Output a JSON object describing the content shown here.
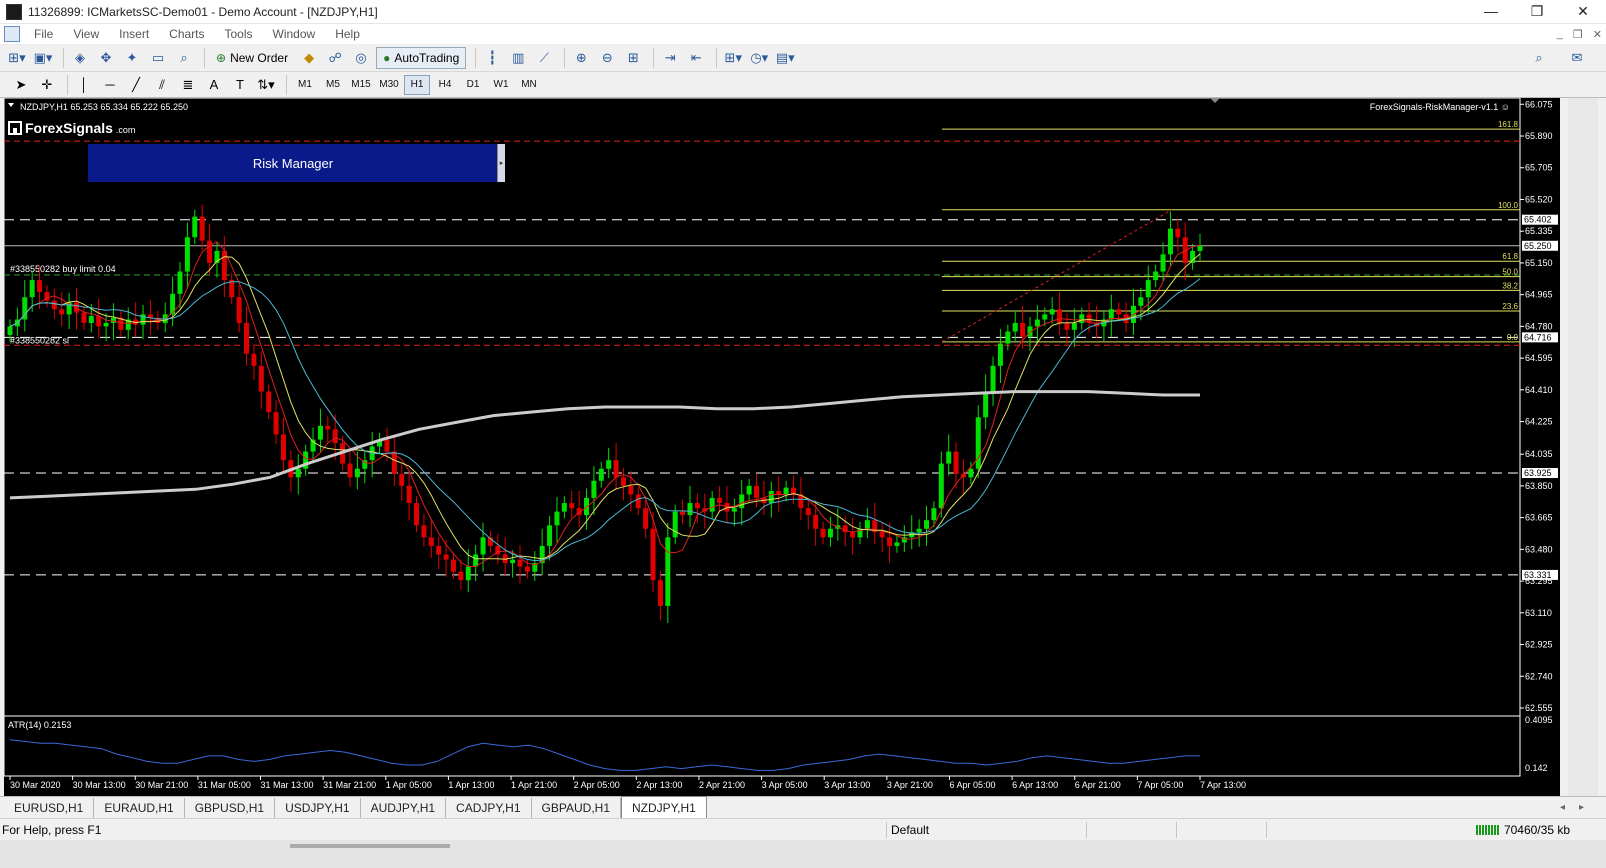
{
  "window": {
    "title": "11326899: ICMarketsSC-Demo01 - Demo Account - [NZDJPY,H1]",
    "minimize": "—",
    "restore": "❐",
    "close": "✕"
  },
  "menu": {
    "items": [
      "File",
      "View",
      "Insert",
      "Charts",
      "Tools",
      "Window",
      "Help"
    ]
  },
  "toolbar": {
    "new_order": "New Order",
    "auto_trading": "AutoTrading"
  },
  "timeframes": [
    "M1",
    "M5",
    "M15",
    "M30",
    "H1",
    "H4",
    "D1",
    "W1",
    "MN"
  ],
  "active_timeframe": "H1",
  "chart": {
    "symbol_line": "NZDJPY,H1  65.253 65.334 65.222 65.250",
    "indicator_name": "ForexSignals-RiskManager-v1.1",
    "logo_text": "ForexSignals",
    "logo_suffix": ".com",
    "risk_manager_label": "Risk Manager",
    "order_label_buy": "#338550282 buy limit 0.04",
    "order_label_sl": "#338550282 sl",
    "atr_label": "ATR(14) 0.2153",
    "colors": {
      "background": "#000000",
      "bull": "#00e000",
      "bear": "#e00000",
      "fib": "#e0e060",
      "ma_slow": "#cccccc",
      "ma_fast_red": "#e02020",
      "ma_yellow": "#e0e060",
      "ma_cyan": "#4cb6d6",
      "atr_line": "#3a6ad8",
      "price_grid": "#ffffff"
    }
  },
  "chart_data": {
    "type": "candlestick",
    "symbol": "NZDJPY",
    "timeframe": "H1",
    "price_axis": [
      "66.075",
      "65.890",
      "65.705",
      "65.520",
      "65.335",
      "65.150",
      "64.965",
      "64.780",
      "64.595",
      "64.410",
      "64.225",
      "64.035",
      "63.850",
      "63.665",
      "63.480",
      "63.295",
      "63.110",
      "62.925",
      "62.740",
      "62.555"
    ],
    "price_range": [
      62.52,
      66.1
    ],
    "highlighted_prices": [
      "65.402",
      "65.250",
      "64.716",
      "63.925",
      "63.331"
    ],
    "fib_levels": [
      {
        "label": "161.8",
        "price": 65.93
      },
      {
        "label": "100.0",
        "price": 65.46
      },
      {
        "label": "61.8",
        "price": 65.16
      },
      {
        "label": "50.0",
        "price": 65.07
      },
      {
        "label": "38.2",
        "price": 64.99
      },
      {
        "label": "23.6",
        "price": 64.87
      },
      {
        "label": "0.0",
        "price": 64.69
      }
    ],
    "horizontal_lines": [
      {
        "style": "dash-red",
        "price": 65.86
      },
      {
        "style": "dash-white",
        "price": 65.402
      },
      {
        "style": "solid-white",
        "price": 65.25
      },
      {
        "style": "dash-green",
        "price": 65.08
      },
      {
        "style": "dash-white",
        "price": 64.716
      },
      {
        "style": "dash-red",
        "price": 64.67
      },
      {
        "style": "dash-white",
        "price": 63.925
      },
      {
        "style": "dash-white",
        "price": 63.331
      }
    ],
    "time_labels": [
      "30 Mar 2020",
      "30 Mar 13:00",
      "30 Mar 21:00",
      "31 Mar 05:00",
      "31 Mar 13:00",
      "31 Mar 21:00",
      "1 Apr 05:00",
      "1 Apr 13:00",
      "1 Apr 21:00",
      "2 Apr 05:00",
      "2 Apr 13:00",
      "2 Apr 21:00",
      "3 Apr 05:00",
      "3 Apr 13:00",
      "3 Apr 21:00",
      "6 Apr 05:00",
      "6 Apr 13:00",
      "6 Apr 21:00",
      "7 Apr 05:00",
      "7 Apr 13:00"
    ],
    "closes": [
      64.78,
      64.82,
      64.95,
      65.05,
      64.98,
      64.93,
      64.88,
      64.85,
      64.92,
      64.86,
      64.8,
      64.84,
      64.78,
      64.8,
      64.83,
      64.76,
      64.82,
      64.79,
      64.85,
      64.83,
      64.8,
      64.85,
      64.97,
      65.1,
      65.3,
      65.42,
      65.28,
      65.15,
      65.22,
      65.05,
      64.95,
      64.8,
      64.62,
      64.55,
      64.4,
      64.28,
      64.15,
      64.0,
      63.9,
      63.95,
      64.05,
      64.12,
      64.2,
      64.18,
      64.1,
      63.98,
      63.9,
      63.95,
      64.0,
      64.08,
      64.12,
      64.05,
      63.92,
      63.85,
      63.75,
      63.62,
      63.55,
      63.5,
      63.45,
      63.42,
      63.35,
      63.3,
      63.38,
      63.45,
      63.55,
      63.5,
      63.45,
      63.4,
      63.42,
      63.38,
      63.35,
      63.4,
      63.5,
      63.62,
      63.7,
      63.75,
      63.72,
      63.68,
      63.78,
      63.88,
      63.95,
      64.0,
      63.9,
      63.85,
      63.8,
      63.72,
      63.6,
      63.3,
      63.15,
      63.55,
      63.7,
      63.68,
      63.75,
      63.72,
      63.7,
      63.78,
      63.75,
      63.7,
      63.72,
      63.8,
      63.85,
      63.78,
      63.75,
      63.82,
      63.8,
      63.84,
      63.8,
      63.72,
      63.68,
      63.6,
      63.55,
      63.6,
      63.62,
      63.58,
      63.55,
      63.6,
      63.65,
      63.58,
      63.55,
      63.5,
      63.52,
      63.55,
      63.58,
      63.6,
      63.65,
      63.72,
      63.98,
      64.05,
      63.92,
      63.9,
      63.95,
      64.25,
      64.4,
      64.55,
      64.68,
      64.75,
      64.8,
      64.72,
      64.78,
      64.82,
      64.85,
      64.88,
      64.8,
      64.76,
      64.8,
      64.85,
      64.8,
      64.78,
      64.82,
      64.88,
      64.85,
      64.8,
      64.9,
      64.95,
      65.05,
      65.1,
      65.2,
      65.35,
      65.3,
      65.15,
      65.22,
      65.25
    ],
    "ma_slow": [
      63.78,
      63.79,
      63.8,
      63.81,
      63.82,
      63.83,
      63.86,
      63.9,
      63.98,
      64.05,
      64.12,
      64.18,
      64.22,
      64.26,
      64.28,
      64.3,
      64.31,
      64.31,
      64.31,
      64.3,
      64.3,
      64.31,
      64.33,
      64.35,
      64.37,
      64.38,
      64.39,
      64.4,
      64.4,
      64.4,
      64.39,
      64.38,
      64.38
    ],
    "atr_axis": [
      "0.4095",
      "0.142"
    ],
    "atr_range": [
      0.11,
      0.42
    ],
    "atr": [
      0.3,
      0.29,
      0.28,
      0.28,
      0.27,
      0.26,
      0.25,
      0.22,
      0.2,
      0.18,
      0.17,
      0.17,
      0.19,
      0.21,
      0.21,
      0.19,
      0.18,
      0.19,
      0.21,
      0.22,
      0.23,
      0.24,
      0.23,
      0.21,
      0.19,
      0.17,
      0.16,
      0.16,
      0.18,
      0.22,
      0.26,
      0.28,
      0.27,
      0.26,
      0.27,
      0.25,
      0.22,
      0.19,
      0.16,
      0.14,
      0.13,
      0.13,
      0.14,
      0.15,
      0.14,
      0.15,
      0.16,
      0.15,
      0.14,
      0.13,
      0.13,
      0.14,
      0.16,
      0.17,
      0.18,
      0.19,
      0.21,
      0.22,
      0.21,
      0.2,
      0.19,
      0.18,
      0.17,
      0.17,
      0.16,
      0.17,
      0.18,
      0.2,
      0.21,
      0.2,
      0.19,
      0.18,
      0.17,
      0.17,
      0.18,
      0.19,
      0.2,
      0.21,
      0.21
    ]
  },
  "tabs": [
    "EURUSD,H1",
    "EURAUD,H1",
    "GBPUSD,H1",
    "USDJPY,H1",
    "AUDJPY,H1",
    "CADJPY,H1",
    "GBPAUD,H1",
    "NZDJPY,H1"
  ],
  "active_tab": "NZDJPY,H1",
  "status": {
    "help": "For Help, press F1",
    "profile": "Default",
    "traffic": "70460/35 kb"
  }
}
